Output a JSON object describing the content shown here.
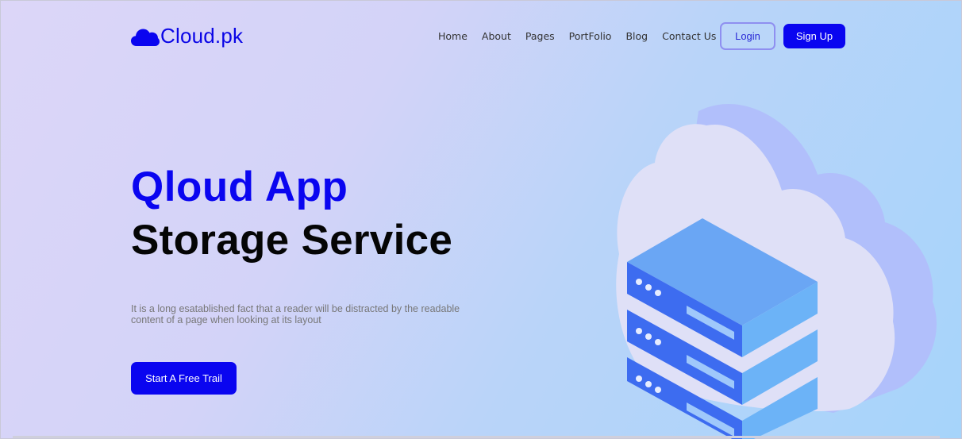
{
  "brand": {
    "name": "Cloud.pk",
    "logo_icon": "cloud-icon"
  },
  "nav": {
    "items": [
      {
        "label": "Home"
      },
      {
        "label": "About"
      },
      {
        "label": "Pages"
      },
      {
        "label": "PortFolio"
      },
      {
        "label": "Blog"
      },
      {
        "label": "Contact Us"
      }
    ],
    "login_label": "Login",
    "signup_label": "Sign Up"
  },
  "hero": {
    "title_line1": "Qloud App",
    "title_line2": "Storage Service",
    "description": "It is a long esatablished fact that a reader will be distracted by the readable content of a page when looking at its layout",
    "cta_label": "Start A Free Trail"
  },
  "colors": {
    "accent": "#0a05f0",
    "heading": "#050505",
    "muted": "#777777"
  },
  "illustration": {
    "icon": "cloud-server-illustration"
  }
}
